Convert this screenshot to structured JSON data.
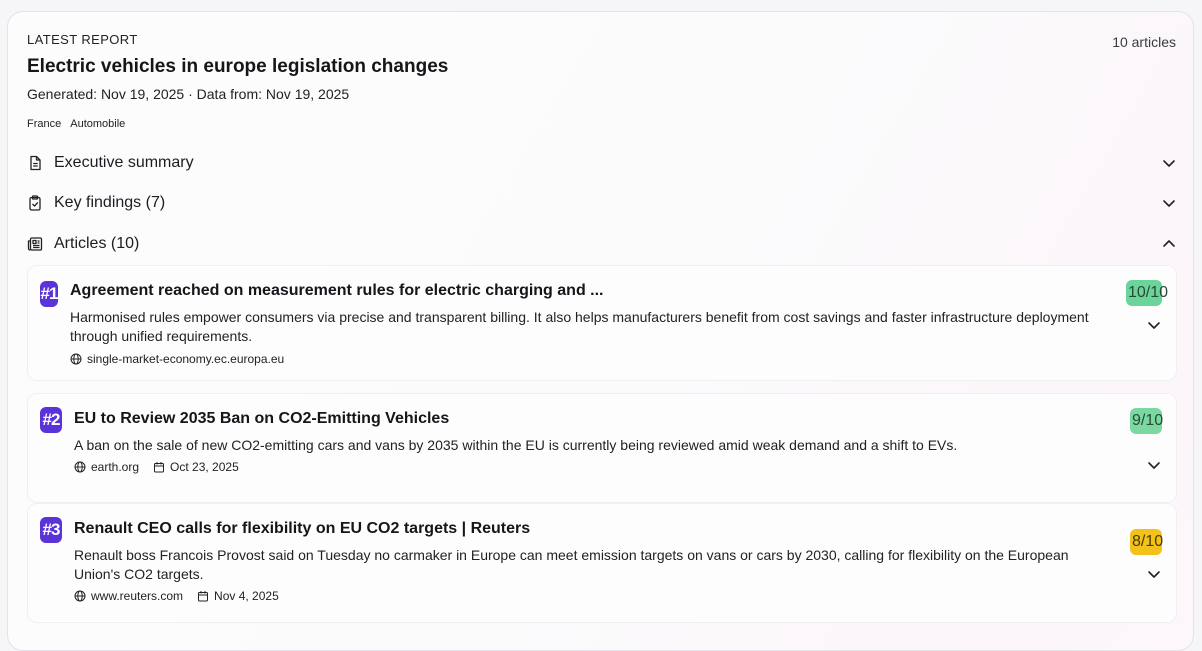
{
  "report": {
    "eyebrow": "LATEST REPORT",
    "article_count": "10 articles",
    "title": "Electric vehicles in europe legislation changes",
    "meta": "Generated: Nov 19, 2025 · Data from: Nov 19, 2025",
    "tags": [
      "France",
      "Automobile"
    ]
  },
  "sections": {
    "summary": {
      "label": "Executive summary",
      "icon": "document-icon",
      "state": "collapsed"
    },
    "findings": {
      "label": "Key findings (7)",
      "icon": "clipboard-check-icon",
      "state": "collapsed"
    },
    "articles": {
      "label": "Articles (10)",
      "icon": "newspaper-icon",
      "state": "expanded"
    }
  },
  "articles": [
    {
      "rank": "#1",
      "title": "Agreement reached on measurement rules for electric charging and ...",
      "description": "Harmonised rules empower consumers via precise and transparent billing. It also helps manufacturers benefit from cost savings and faster infrastructure deployment through unified requirements.",
      "source": "single-market-economy.ec.europa.eu",
      "date": "",
      "score": "10/10",
      "score_color": "#6ad49a"
    },
    {
      "rank": "#2",
      "title": "EU to Review 2035 Ban on CO2-Emitting Vehicles",
      "description": "A ban on the sale of new CO2-emitting cars and vans by 2035 within the EU is currently being reviewed amid weak demand and a shift to EVs.",
      "source": "earth.org",
      "date": "Oct 23, 2025",
      "score": "9/10",
      "score_color": "#7ad8a0"
    },
    {
      "rank": "#3",
      "title": "Renault CEO calls for flexibility on EU CO2 targets | Reuters",
      "description": "Renault boss Francois Provost said on Tuesday no carmaker in Europe can meet emission targets on vans or cars by 2030, calling for flexibility on the European Union's CO2 targets.",
      "source": "www.reuters.com",
      "date": "Nov 4, 2025",
      "score": "8/10",
      "score_color": "#f2c21b"
    }
  ],
  "colors": {
    "rank_badge": "#5b34d9",
    "score_high": "#6ad49a",
    "score_mid": "#f2c21b"
  }
}
